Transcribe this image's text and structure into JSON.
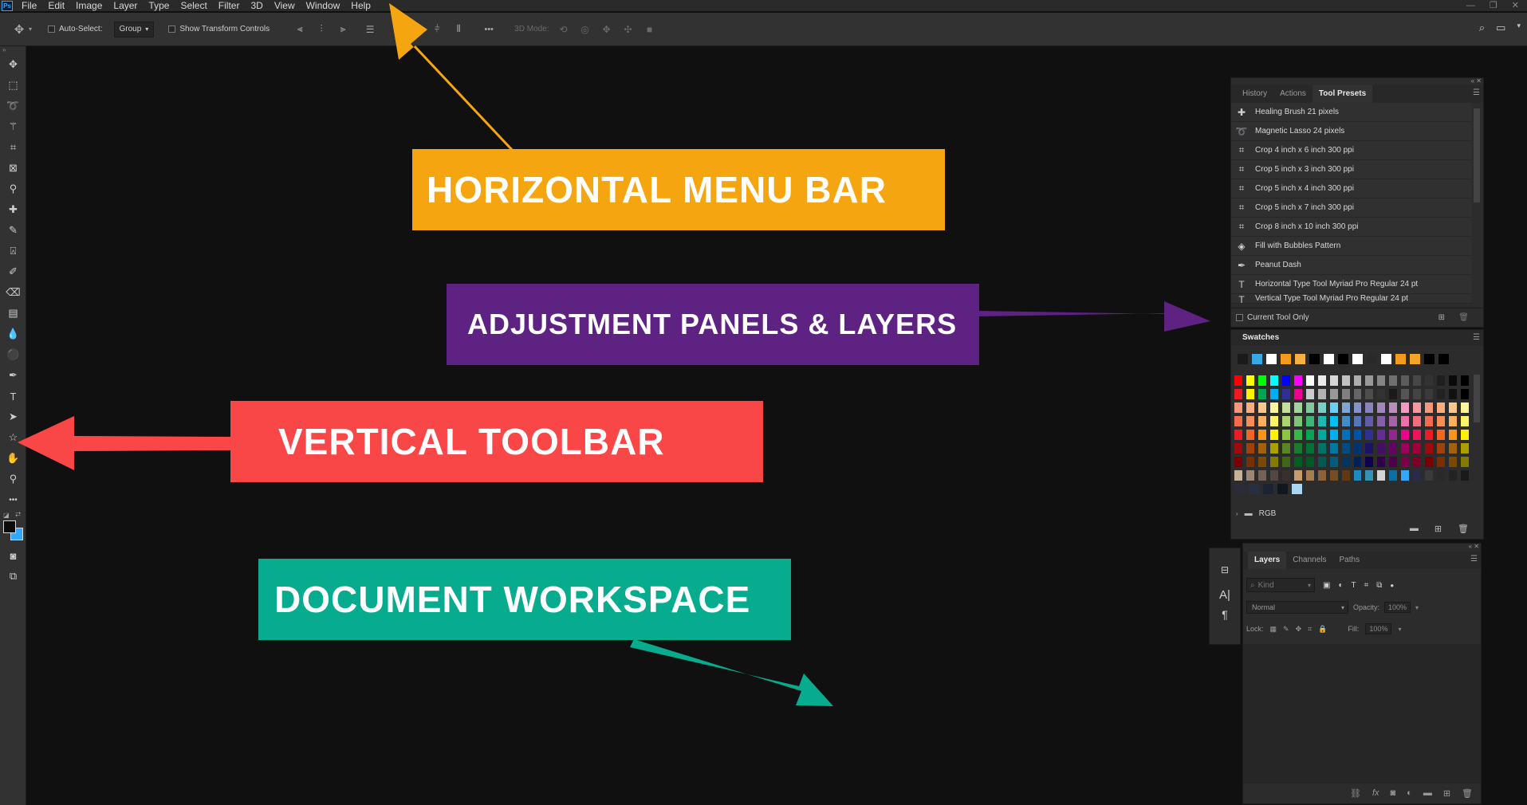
{
  "menubar": {
    "logo": "Ps",
    "items": [
      "File",
      "Edit",
      "Image",
      "Layer",
      "Type",
      "Select",
      "Filter",
      "3D",
      "View",
      "Window",
      "Help"
    ]
  },
  "options_bar": {
    "auto_select_label": "Auto-Select:",
    "group_select": "Group",
    "show_transform_label": "Show Transform Controls",
    "more": "•••",
    "mode_label": "3D Mode:"
  },
  "tool_presets_panel": {
    "tabs": [
      "History",
      "Actions",
      "Tool Presets"
    ],
    "active_tab": "Tool Presets",
    "presets": [
      "Healing Brush 21 pixels",
      "Magnetic Lasso 24 pixels",
      "Crop 4 inch x 6 inch 300 ppi",
      "Crop 5 inch x 3 inch 300 ppi",
      "Crop 5 inch x 4 inch 300 ppi",
      "Crop 5 inch x 7 inch 300 ppi",
      "Crop 8 inch x 10 inch 300 ppi",
      "Fill with Bubbles Pattern",
      "Peanut Dash",
      "Horizontal Type Tool Myriad Pro Regular 24 pt",
      "Vertical Type Tool Myriad Pro Regular 24 pt"
    ],
    "current_tool_only": "Current Tool Only"
  },
  "swatches_panel": {
    "title": "Swatches",
    "recent": [
      "#1a1a1a",
      "#3aa7e6",
      "#ffffff",
      "#f29b1d",
      "#f5b040",
      "#000000",
      "#ffffff",
      "#000000",
      "#ffffff",
      "#2a2a2a",
      "#ffffff",
      "#f29b1d",
      "#f5a42a",
      "#000000",
      "#000000"
    ],
    "rows": [
      [
        "#ff0000",
        "#ffff00",
        "#00ff00",
        "#00ffff",
        "#0000ff",
        "#ff00ff",
        "#ffffff",
        "#ebebeb",
        "#d6d6d6",
        "#c2c2c2",
        "#adadad",
        "#999999",
        "#858585",
        "#707070",
        "#5c5c5c",
        "#474747",
        "#333333",
        "#1f1f1f",
        "#0a0a0a",
        "#000000"
      ],
      [
        "#ed1c24",
        "#fff200",
        "#00a651",
        "#00aeef",
        "#2e3192",
        "#ec008c",
        "#cccccc",
        "#b3b3b3",
        "#999999",
        "#808080",
        "#666666",
        "#4d4d4d",
        "#333333",
        "#1a1a1a",
        "#555555",
        "#444444",
        "#3a3a3a",
        "#222222",
        "#111111",
        "#000000"
      ],
      [
        "#f7977a",
        "#f9ad81",
        "#fdc68a",
        "#fff79a",
        "#c4df9b",
        "#a3d39c",
        "#82ca9d",
        "#7bcdc8",
        "#6ecff6",
        "#7ea7d8",
        "#8493ca",
        "#8882be",
        "#a187be",
        "#bc8dbf",
        "#f49ac2",
        "#f6989d",
        "#f7977a",
        "#f9ad81",
        "#fdc68a",
        "#fff79a"
      ],
      [
        "#f26c4f",
        "#f68e55",
        "#fbaf5c",
        "#fff467",
        "#acd372",
        "#7cc576",
        "#3bb878",
        "#1abbb4",
        "#00bff3",
        "#438ccb",
        "#5574b9",
        "#605ca8",
        "#855fa8",
        "#a763a8",
        "#f06ea9",
        "#f26d7d",
        "#f26c4f",
        "#f68e55",
        "#fbaf5c",
        "#fff467"
      ],
      [
        "#ed1c24",
        "#f26522",
        "#f7941d",
        "#fff200",
        "#8dc63f",
        "#39b54a",
        "#00a651",
        "#00a99d",
        "#00aeef",
        "#0072bc",
        "#0054a6",
        "#2e3192",
        "#662d91",
        "#92278f",
        "#ec008c",
        "#ed145b",
        "#ed1c24",
        "#f26522",
        "#f7941d",
        "#fff200"
      ],
      [
        "#9e0b0f",
        "#a0410d",
        "#a36209",
        "#aba000",
        "#598527",
        "#1a7b30",
        "#007236",
        "#00746b",
        "#0076a3",
        "#004b80",
        "#003471",
        "#1b1464",
        "#440e62",
        "#630460",
        "#9e005d",
        "#9e0039",
        "#9e0b0f",
        "#a0410d",
        "#a36209",
        "#aba000"
      ],
      [
        "#790000",
        "#7b2e00",
        "#7d4900",
        "#827b00",
        "#406618",
        "#005e20",
        "#005826",
        "#005952",
        "#005b7f",
        "#003663",
        "#002157",
        "#0d004c",
        "#32004b",
        "#4b0049",
        "#7b0046",
        "#7a0026",
        "#790000",
        "#7b2e00",
        "#7d4900",
        "#827b00"
      ],
      [
        "#c7b299",
        "#998675",
        "#736357",
        "#534741",
        "#37302d",
        "#c69c6d",
        "#a67c52",
        "#8c6239",
        "#754c24",
        "#603913",
        "#1f8ac0",
        "#3592b5",
        "#d4d4d4",
        "#0a6fa3",
        "#31a8ff",
        "#2a2a4a",
        "#3a3a3a",
        "#2a2a2a",
        "#232323",
        "#1a1a1a"
      ],
      [
        "#2b2b3a",
        "#263040",
        "#1c2433",
        "#12161f",
        "#a9d6f2"
      ]
    ],
    "folder_label": "RGB"
  },
  "layers_panel": {
    "tabs": [
      "Layers",
      "Channels",
      "Paths"
    ],
    "active_tab": "Layers",
    "kind_placeholder": "Kind",
    "blend_mode": "Normal",
    "opacity_label": "Opacity:",
    "opacity_value": "100%",
    "lock_label": "Lock:",
    "fill_label": "Fill:",
    "fill_value": "100%",
    "footer_fx": "fx"
  },
  "callouts": {
    "menu_bar": "HORIZONTAL MENU BAR",
    "panels": "ADJUSTMENT PANELS & LAYERS",
    "toolbar": "VERTICAL TOOLBAR",
    "workspace": "DOCUMENT WORKSPACE"
  },
  "colors": {
    "orange": "#f5a50f",
    "purple": "#5e2283",
    "red": "#f94646",
    "teal": "#06ac8d"
  }
}
